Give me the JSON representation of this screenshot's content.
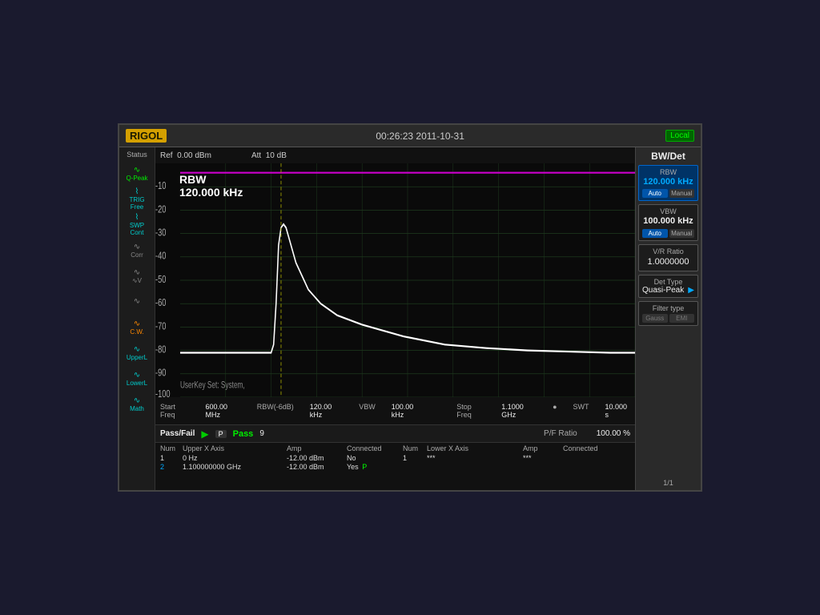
{
  "header": {
    "logo": "RIGOL",
    "timestamp": "00:26:23 2011-10-31",
    "local_badge": "Local",
    "ref_label": "Ref",
    "ref_value": "0.00 dBm",
    "att_label": "Att",
    "att_value": "10 dB"
  },
  "sidebar": {
    "status_label": "Status",
    "buttons": [
      {
        "icon": "∿",
        "label": "Q-Peak",
        "color": "green"
      },
      {
        "icon": "⌇",
        "label": "TRIG\nFree",
        "color": "cyan"
      },
      {
        "icon": "⌇",
        "label": "SWP\nCont",
        "color": "cyan"
      },
      {
        "icon": "∿",
        "label": "Corr",
        "color": "gray"
      },
      {
        "icon": "∿",
        "label": "∿V",
        "color": "gray"
      },
      {
        "icon": "∿",
        "label": "",
        "color": "gray"
      },
      {
        "icon": "∿",
        "label": "C.W.",
        "color": "orange"
      },
      {
        "icon": "∿",
        "label": "UpperL",
        "color": "cyan"
      },
      {
        "icon": "∿",
        "label": "LowerL",
        "color": "cyan"
      },
      {
        "icon": "∿",
        "label": "Math",
        "color": "cyan"
      }
    ]
  },
  "chart": {
    "rbw_annotation_line1": "RBW",
    "rbw_annotation_line2": "120.000 kHz",
    "userkey_label": "UserKey Set:  System,",
    "y_labels": [
      "-10",
      "-20",
      "-30",
      "-40",
      "-50",
      "-60",
      "-70",
      "-80",
      "-90",
      "-100"
    ],
    "footer": {
      "start_freq_label": "Start Freq",
      "start_freq_value": "600.00 MHz",
      "rbw_label": "RBW(-6dB)",
      "rbw_value": "120.00 kHz",
      "vbw_label": "VBW",
      "vbw_value": "100.00 kHz",
      "stop_freq_label": "Stop Freq",
      "stop_freq_value": "1.1000 GHz",
      "swt_label": "SWT",
      "swt_value": "10.000 s"
    }
  },
  "pass_fail": {
    "label": "Pass/Fail",
    "pass_text": "Pass",
    "num_value": "9",
    "pf_ratio_label": "P/F Ratio",
    "pf_ratio_value": "100.00 %",
    "p_marker": "P"
  },
  "table": {
    "headers": [
      "Num",
      "Upper X Axis",
      "Amp",
      "Connected",
      "Num",
      "Lower X Axis",
      "Amp",
      "Connected"
    ],
    "rows": [
      {
        "num": "1",
        "upper_x": "0 Hz",
        "amp": "-12.00 dBm",
        "connected": "No",
        "num2": "1",
        "lower_x": "***",
        "amp2": "***",
        "connected2": ""
      },
      {
        "num": "2",
        "upper_x": "1.100000000 GHz",
        "amp": "-12.00 dBm",
        "connected": "Yes",
        "num2": "",
        "lower_x": "",
        "amp2": "",
        "connected2": ""
      }
    ]
  },
  "right_panel": {
    "title": "BW/Det",
    "rbw_label": "RBW",
    "rbw_value": "120.000 kHz",
    "rbw_auto": "Auto",
    "rbw_manual": "Manual",
    "vbw_label": "VBW",
    "vbw_value": "100.000 kHz",
    "vbw_auto": "Auto",
    "vbw_manual": "Manual",
    "vr_label": "V/R Ratio",
    "vr_value": "1.0000000",
    "det_label": "Det Type",
    "det_value": "Quasi-Peak",
    "filter_label": "Filter type",
    "filter_gauss": "Gauss",
    "filter_emi": "EMI",
    "page": "1/1"
  }
}
